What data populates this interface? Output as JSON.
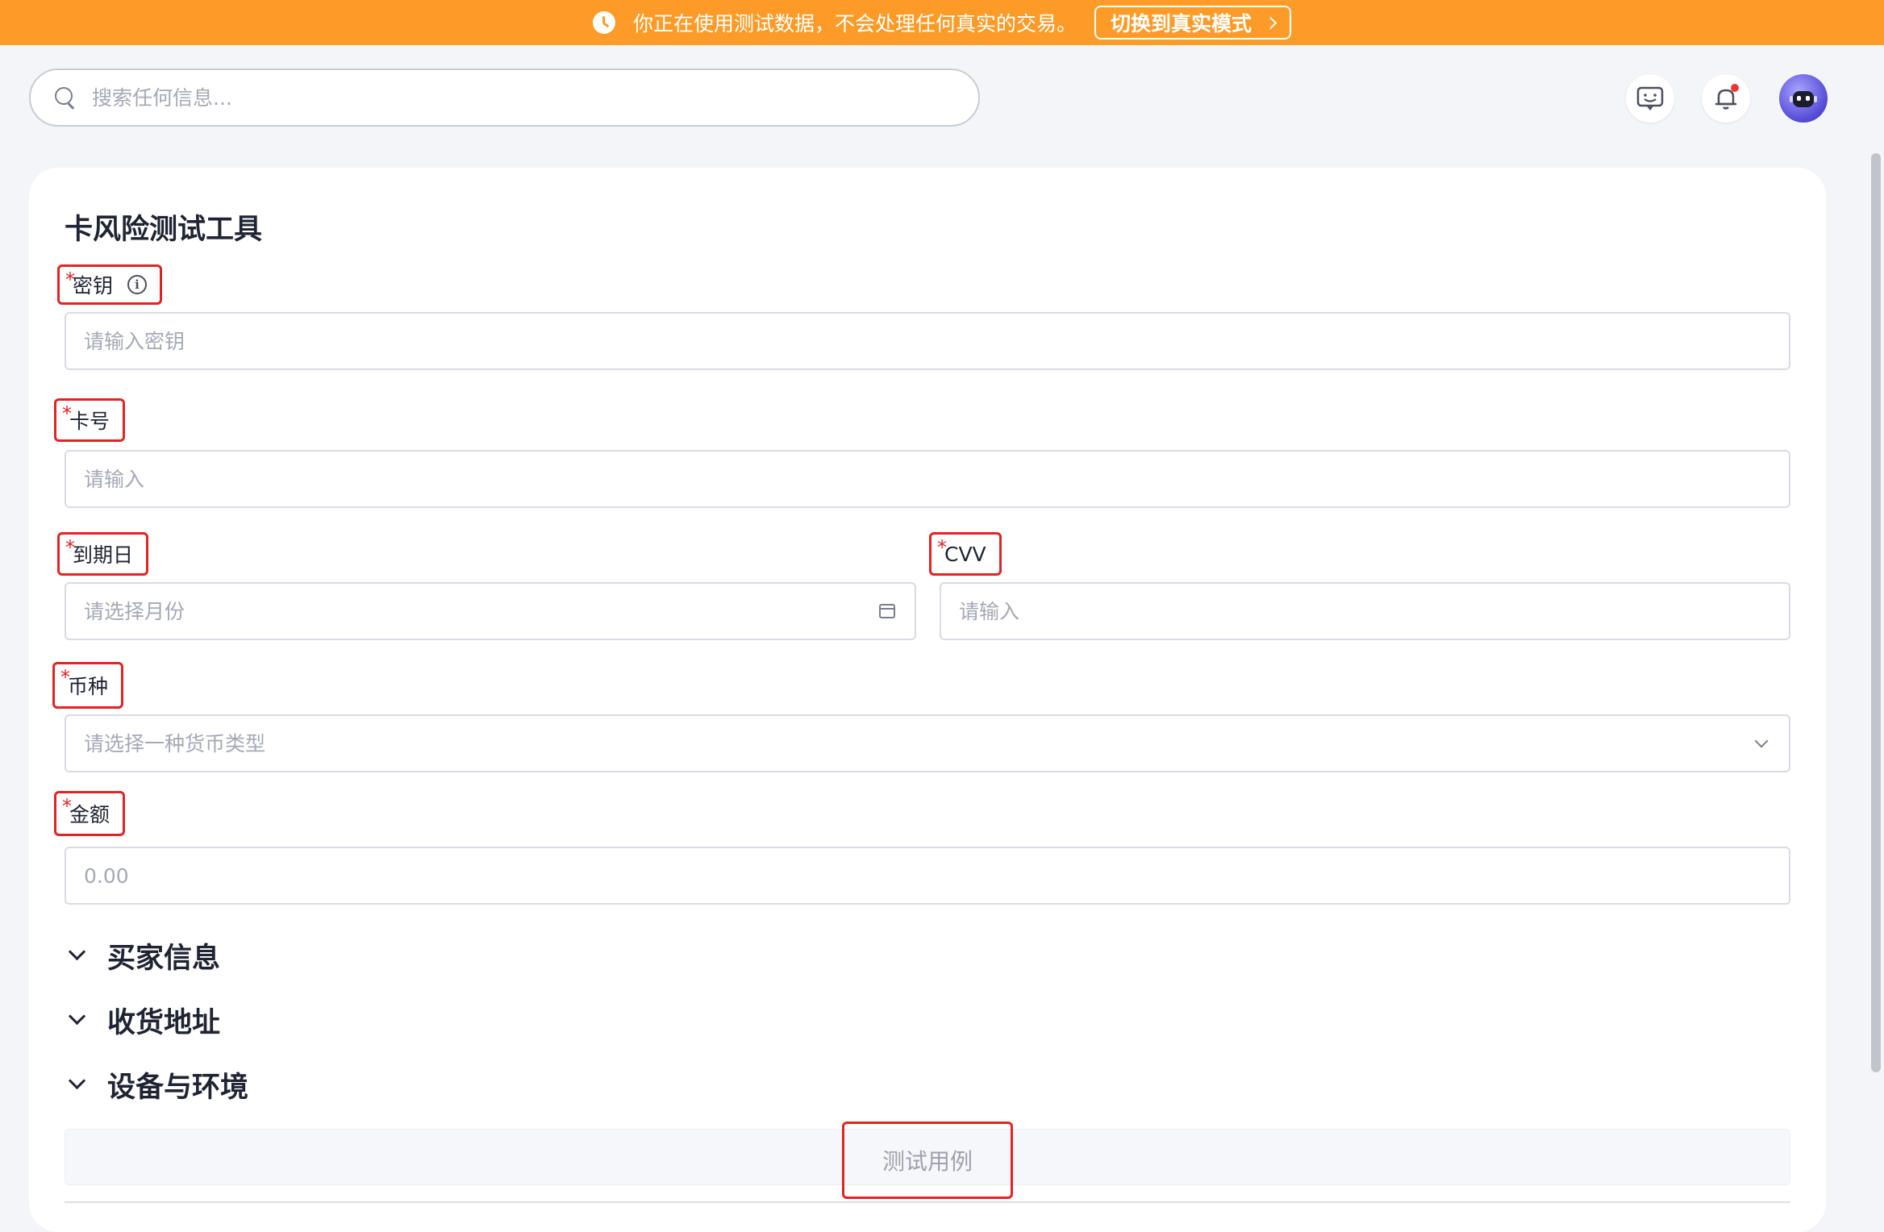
{
  "banner": {
    "message": "你正在使用测试数据，不会处理任何真实的交易。",
    "switch_label": "切换到真实模式"
  },
  "search": {
    "placeholder": "搜索任何信息..."
  },
  "form": {
    "title": "卡风险测试工具",
    "secret_key": {
      "label": "密钥",
      "placeholder": "请输入密钥"
    },
    "card_number": {
      "label": "卡号",
      "placeholder": "请输入"
    },
    "expiry": {
      "label": "到期日",
      "placeholder": "请选择月份"
    },
    "cvv": {
      "label": "CVV",
      "placeholder": "请输入"
    },
    "currency": {
      "label": "币种",
      "placeholder": "请选择一种货币类型"
    },
    "amount": {
      "label": "金额",
      "placeholder": "0.00"
    },
    "required_mark": "*"
  },
  "sections": [
    {
      "label": "买家信息"
    },
    {
      "label": "收货地址"
    },
    {
      "label": "设备与环境"
    }
  ],
  "actions": {
    "test_case_label": "测试用例"
  },
  "colors": {
    "banner": "#fd9b28",
    "required": "#e02424",
    "notification_dot": "#f03535"
  }
}
